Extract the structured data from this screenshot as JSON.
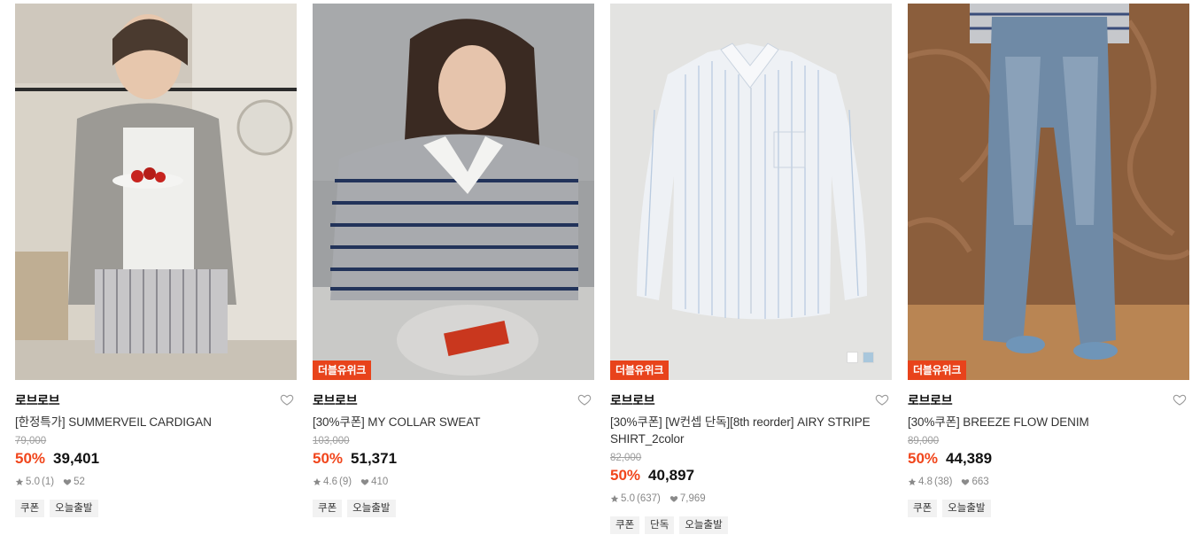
{
  "products": [
    {
      "brand": "로브로브",
      "name": "[한정특가] SUMMERVEIL CARDIGAN",
      "original_price": "79,000",
      "discount": "50%",
      "price": "39,401",
      "rating": "5.0",
      "reviews": "(1)",
      "likes": "52",
      "badge": "",
      "tags": [
        "쿠폰",
        "오늘출발"
      ]
    },
    {
      "brand": "로브로브",
      "name": "[30%쿠폰] MY COLLAR SWEAT",
      "original_price": "103,000",
      "discount": "50%",
      "price": "51,371",
      "rating": "4.6",
      "reviews": "(9)",
      "likes": "410",
      "badge": "더블유위크",
      "tags": [
        "쿠폰",
        "오늘출발"
      ]
    },
    {
      "brand": "로브로브",
      "name": "[30%쿠폰] [W컨셉 단독][8th reorder] AIRY STRIPE SHIRT_2color",
      "original_price": "82,000",
      "discount": "50%",
      "price": "40,897",
      "rating": "5.0",
      "reviews": "(637)",
      "likes": "7,969",
      "badge": "더블유위크",
      "tags": [
        "쿠폰",
        "단독",
        "오늘출발"
      ],
      "swatch_colors": [
        "#ffffff",
        "#a9c7dc"
      ]
    },
    {
      "brand": "로브로브",
      "name": "[30%쿠폰] BREEZE FLOW DENIM",
      "original_price": "89,000",
      "discount": "50%",
      "price": "44,389",
      "rating": "4.8",
      "reviews": "(38)",
      "likes": "663",
      "badge": "더블유위크",
      "tags": [
        "쿠폰",
        "오늘출발"
      ]
    }
  ],
  "colors": {
    "accent": "#f1461c",
    "badge_bg": "#e8431b"
  },
  "icons": {
    "wishlist": "heart-outline-icon",
    "rating": "star-icon",
    "likes": "heart-filled-icon"
  }
}
